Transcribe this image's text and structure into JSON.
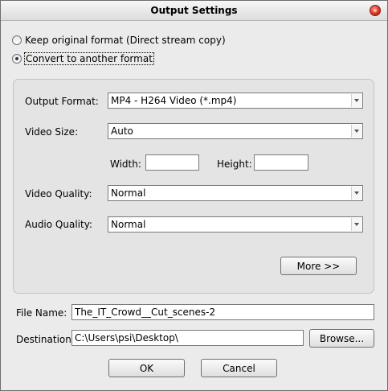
{
  "window": {
    "title": "Output Settings"
  },
  "mode": {
    "keep_original_label": "Keep original format (Direct stream copy)",
    "convert_label": "Convert to another format",
    "selected": "convert"
  },
  "format": {
    "output_format_label": "Output Format:",
    "output_format_value": "MP4 - H264 Video (*.mp4)",
    "video_size_label": "Video Size:",
    "video_size_value": "Auto",
    "width_label": "Width:",
    "width_value": "",
    "height_label": "Height:",
    "height_value": "",
    "video_quality_label": "Video Quality:",
    "video_quality_value": "Normal",
    "audio_quality_label": "Audio Quality:",
    "audio_quality_value": "Normal",
    "more_button": "More >>"
  },
  "file": {
    "file_name_label": "File Name:",
    "file_name_value": "The_IT_Crowd__Cut_scenes-2",
    "destination_label": "Destination:",
    "destination_value": "C:\\Users\\psi\\Desktop\\",
    "browse_button": "Browse..."
  },
  "actions": {
    "ok_button": "OK",
    "cancel_button": "Cancel"
  }
}
